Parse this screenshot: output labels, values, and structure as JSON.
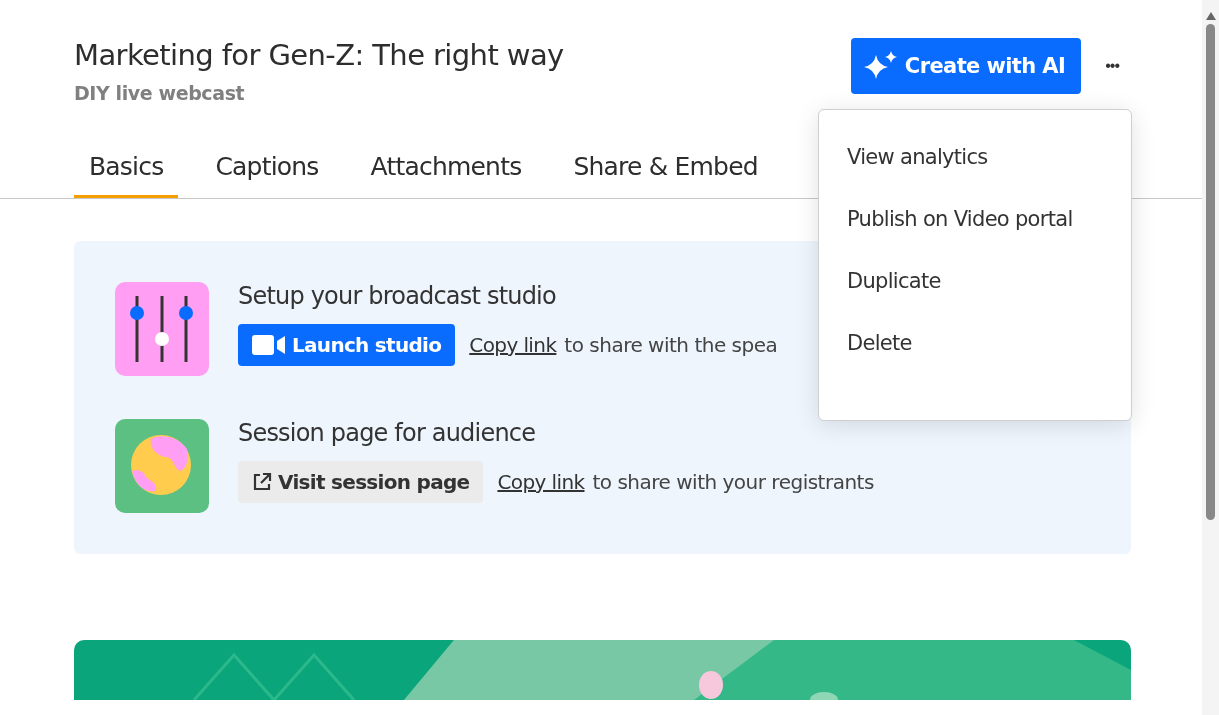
{
  "header": {
    "title": "Marketing for Gen-Z: The right way",
    "subtitle": "DIY live webcast",
    "ai_button": "Create with AI",
    "more_button": "•••"
  },
  "tabs": [
    {
      "label": "Basics",
      "selected": true
    },
    {
      "label": "Captions",
      "selected": false
    },
    {
      "label": "Attachments",
      "selected": false
    },
    {
      "label": "Share & Embed",
      "selected": false
    }
  ],
  "sections": [
    {
      "kind": "studio",
      "title": "Setup your broadcast studio",
      "action": "Launch studio",
      "link": "Copy link",
      "hint": "to share with the spea"
    },
    {
      "kind": "session",
      "title": "Session page for audience",
      "action": "Visit session page",
      "link": "Copy link",
      "hint": "to share with your registrants"
    }
  ],
  "menu": {
    "items": [
      "View analytics",
      "Publish on Video portal",
      "Duplicate",
      "Delete"
    ]
  }
}
